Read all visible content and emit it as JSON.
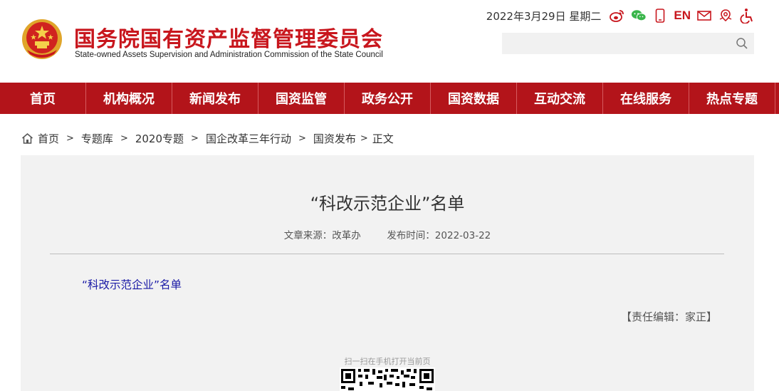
{
  "header": {
    "title": "国务院国有资产监督管理委员会",
    "subtitle": "State-owned Assets Supervision and Administration Commission of the State Council",
    "date": "2022年3月29日  星期二",
    "en_label": "EN",
    "search_placeholder": "",
    "icons": [
      "weibo-icon",
      "wechat-icon",
      "mobile-icon",
      "en-link",
      "mail-icon",
      "location-icon",
      "accessibility-icon",
      "search-icon"
    ]
  },
  "nav": {
    "items": [
      "首页",
      "机构概况",
      "新闻发布",
      "国资监管",
      "政务公开",
      "国资数据",
      "互动交流",
      "在线服务",
      "热点专题"
    ]
  },
  "breadcrumb": {
    "items": [
      "首页",
      "专题库",
      "2020专题",
      "国企改革三年行动",
      "国资发布",
      "正文"
    ],
    "separator": ">"
  },
  "article": {
    "title": "“科改示范企业”名单",
    "source": "文章来源：改革办",
    "published": "发布时间：2022-03-22",
    "attachment_link": "“科改示范企业”名单",
    "editor": "【责任编辑：家正】",
    "qr_caption": "扫一扫在手机打开当前页"
  },
  "colors": {
    "brand_red": "#c8161d",
    "nav_red": "#b3141a",
    "link_blue": "#1a1aa6",
    "panel_bg": "#f2f2f2"
  }
}
